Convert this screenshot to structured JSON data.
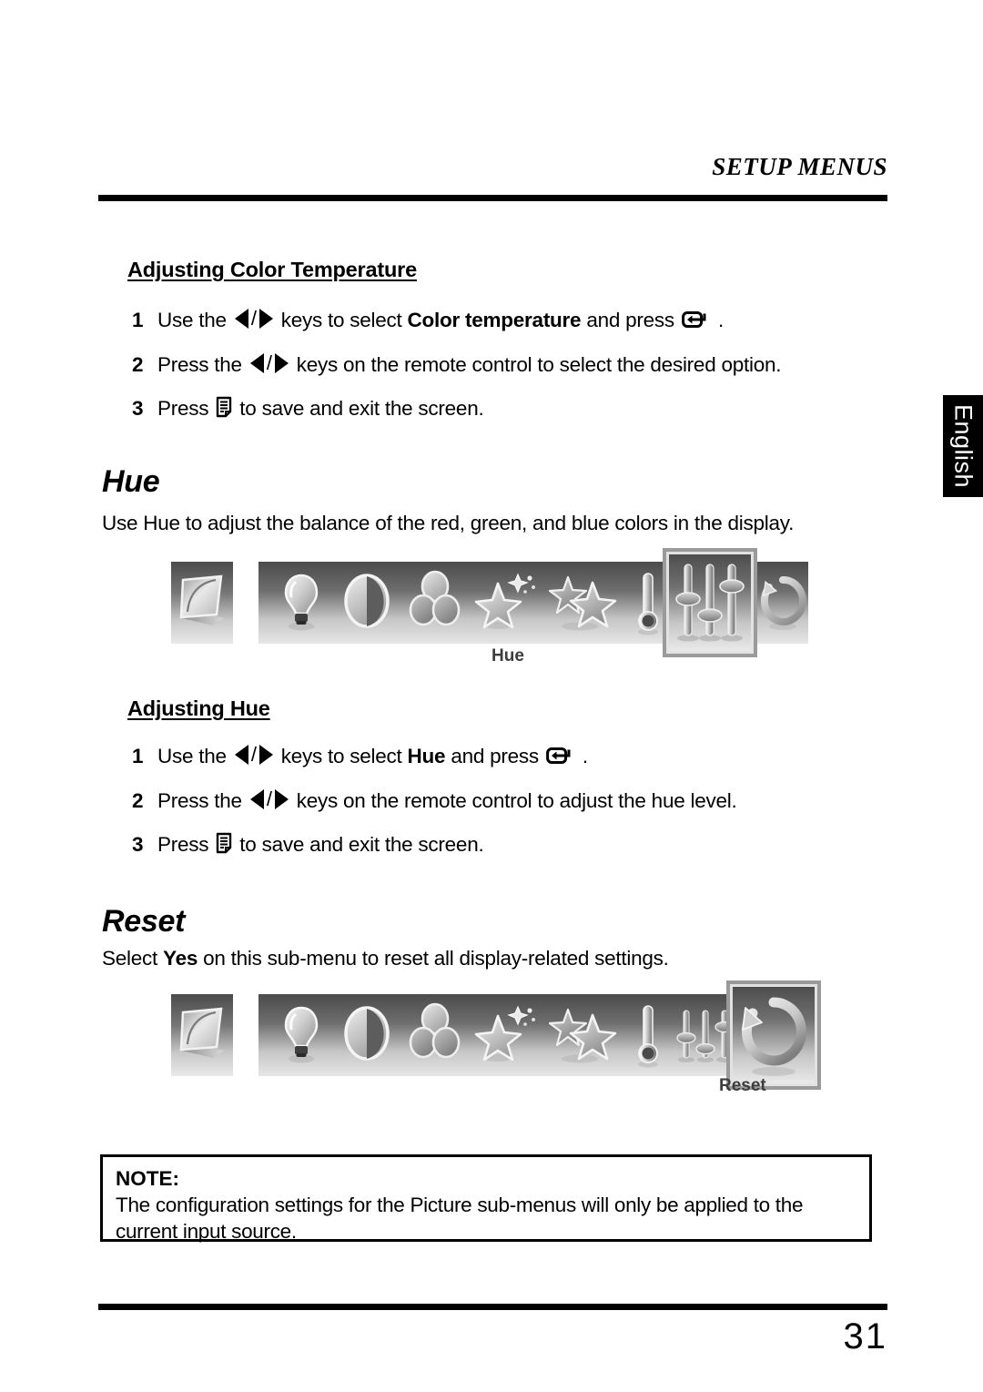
{
  "header": {
    "title": "SETUP MENUS"
  },
  "language_tab": {
    "label": "English"
  },
  "sections": {
    "color_temperature": {
      "heading": "Adjusting Color Temperature",
      "steps": [
        {
          "num": "1",
          "prefix": "Use the",
          "mid": "keys to select",
          "bold_term": "Color temperature",
          "suffix": "and press",
          "end": ".",
          "icons": [
            "arrow-left-key",
            "arrow-right-key",
            "enter-key"
          ]
        },
        {
          "num": "2",
          "prefix": "Press the",
          "mid": "keys on the remote control to select the desired option.",
          "icons": [
            "arrow-left-key",
            "arrow-right-key"
          ]
        },
        {
          "num": "3",
          "prefix": "Press",
          "mid": "to save and exit the screen.",
          "icons": [
            "menu-key"
          ]
        }
      ]
    },
    "hue": {
      "title": "Hue",
      "intro": "Use Hue to adjust the balance of the red, green, and blue colors in the display.",
      "heading": "Adjusting Hue",
      "steps": [
        {
          "num": "1",
          "prefix": "Use the",
          "mid": "keys to select",
          "bold_term": "Hue",
          "suffix": "and press",
          "end": ".",
          "icons": [
            "arrow-left-key",
            "arrow-right-key",
            "enter-key"
          ]
        },
        {
          "num": "2",
          "prefix": "Press the",
          "mid": "keys on the remote control to adjust the hue level.",
          "icons": [
            "arrow-left-key",
            "arrow-right-key"
          ]
        },
        {
          "num": "3",
          "prefix": "Press",
          "mid": "to save and exit the screen.",
          "icons": [
            "menu-key"
          ]
        }
      ]
    },
    "reset": {
      "title": "Reset",
      "intro_pre": "Select",
      "intro_bold": "Yes",
      "intro_post": "on this sub-menu to reset all display-related settings."
    }
  },
  "osd_bars": [
    {
      "name": "hue-osd-bar",
      "selected": "Hue",
      "selected_label": "Hue",
      "items": [
        "display-icon",
        "brightness-bulb-icon",
        "contrast-circle-icon",
        "color-circles-icon",
        "sharpness-star-icon",
        "picture-mode-stars-icon",
        "color-temperature-thermometer-icon",
        "hue-sliders-icon",
        "reset-circular-arrow-icon"
      ]
    },
    {
      "name": "reset-osd-bar",
      "selected": "Reset",
      "selected_label": "Reset",
      "items": [
        "display-icon",
        "brightness-bulb-icon",
        "contrast-circle-icon",
        "color-circles-icon",
        "sharpness-star-icon",
        "picture-mode-stars-icon",
        "color-temperature-thermometer-icon",
        "hue-sliders-icon",
        "reset-circular-arrow-icon"
      ]
    }
  ],
  "note": {
    "label": "NOTE:",
    "text": "The configuration settings for the Picture sub-menus will only be applied to the current input source."
  },
  "footer": {
    "page_number": "31"
  }
}
